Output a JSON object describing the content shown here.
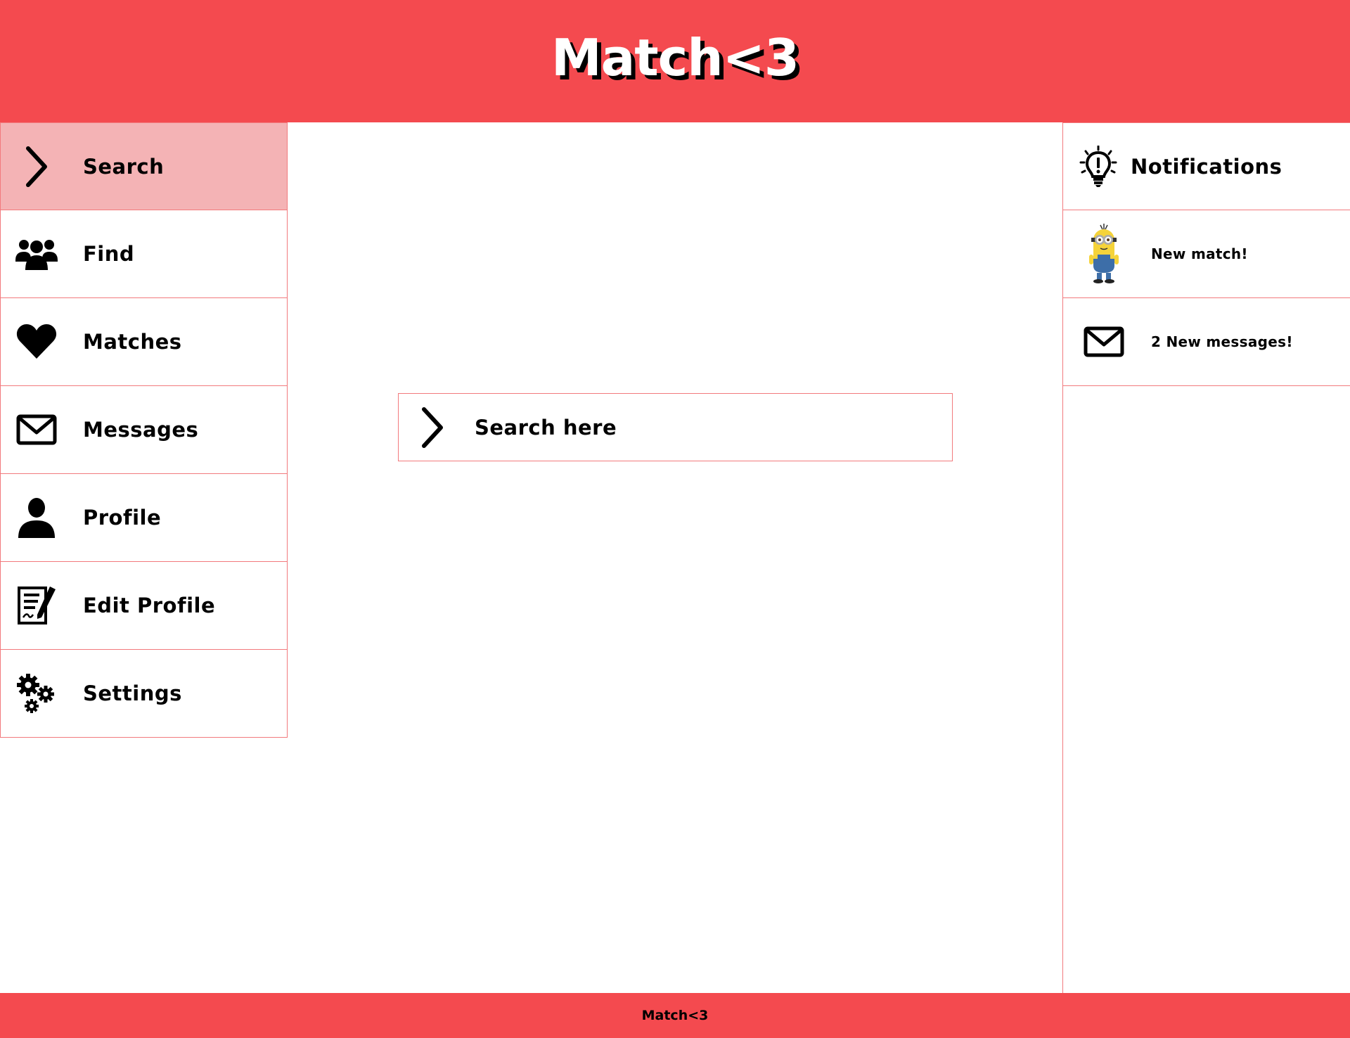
{
  "app": {
    "logo": "Match<3",
    "footer": "Match<3"
  },
  "sidebar": {
    "items": [
      {
        "label": "Search",
        "icon": "chevron-right-icon",
        "active": true
      },
      {
        "label": "Find",
        "icon": "group-icon"
      },
      {
        "label": "Matches",
        "icon": "heart-icon"
      },
      {
        "label": "Messages",
        "icon": "envelope-icon"
      },
      {
        "label": "Profile",
        "icon": "user-icon"
      },
      {
        "label": "Edit Profile",
        "icon": "edit-document-icon"
      },
      {
        "label": "Settings",
        "icon": "gears-icon"
      }
    ]
  },
  "search": {
    "label": "Search here",
    "icon": "chevron-right-icon"
  },
  "notifications": {
    "title": "Notifications",
    "icon": "lightbulb-icon",
    "items": [
      {
        "text": "New match!",
        "icon": "minion-avatar"
      },
      {
        "text": "2 New messages!",
        "icon": "envelope-icon"
      }
    ]
  },
  "colors": {
    "brand": "#f44a4f",
    "active_nav": "#f4b3b5",
    "border": "#f27a7d"
  }
}
